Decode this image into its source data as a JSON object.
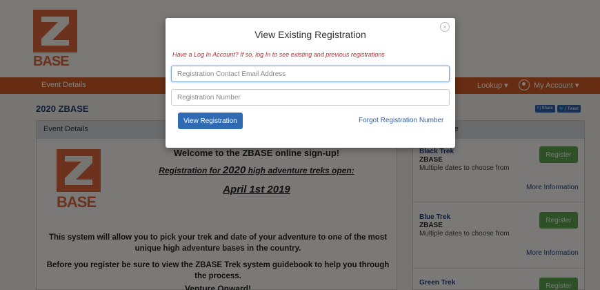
{
  "header": {
    "logo_text": "BASE"
  },
  "navbar": {
    "event_details": "Event Details",
    "lookup": "Lookup ▾",
    "my_account": "My Account ▾"
  },
  "page": {
    "title": "2020 ZBASE",
    "share_facebook": "f | Share",
    "share_twitter": "🐦 | Tweet"
  },
  "main_panel": {
    "heading": "Event Details",
    "logo_text": "BASE",
    "welcome_pre": "Welcome to the ",
    "welcome_brand": "ZBASE",
    "welcome_post": " online sign-up!",
    "reg_pre": "Registration for ",
    "reg_year": "2020",
    "reg_post": " high adventure treks open:",
    "open_date": "April 1st 2019",
    "body1": "This system will allow you to pick your trek and date of your adventure to one of the most unique high adventure bases in the country.",
    "body2": "Before you register be sure to view the ZBASE Trek system guidebook to help you through the process.",
    "body3": "Venture Onward!"
  },
  "side_panel": {
    "heading": "ere",
    "treks": [
      {
        "name": "Black Trek",
        "base": "ZBASE",
        "desc": "Multiple dates to choose from",
        "register": "Register",
        "more": "More Information"
      },
      {
        "name": "Blue Trek",
        "base": "ZBASE",
        "desc": "Multiple dates to choose from",
        "register": "Register",
        "more": "More Information"
      },
      {
        "name": "Green Trek",
        "register": "Register"
      }
    ]
  },
  "modal": {
    "title": "View Existing Registration",
    "close": "×",
    "note": "Have a Log In Account? If so, log In to see existing and previous registrations",
    "email_placeholder": "Registration Contact Email Address",
    "number_placeholder": "Registration Number",
    "view_button": "View Registration",
    "forgot_link": "Forgot Registration Number"
  },
  "colors": {
    "brand_orange": "#cf5a25",
    "primary_blue": "#2f6bb3",
    "register_green": "#5aa04c",
    "note_red": "#c7262b"
  }
}
